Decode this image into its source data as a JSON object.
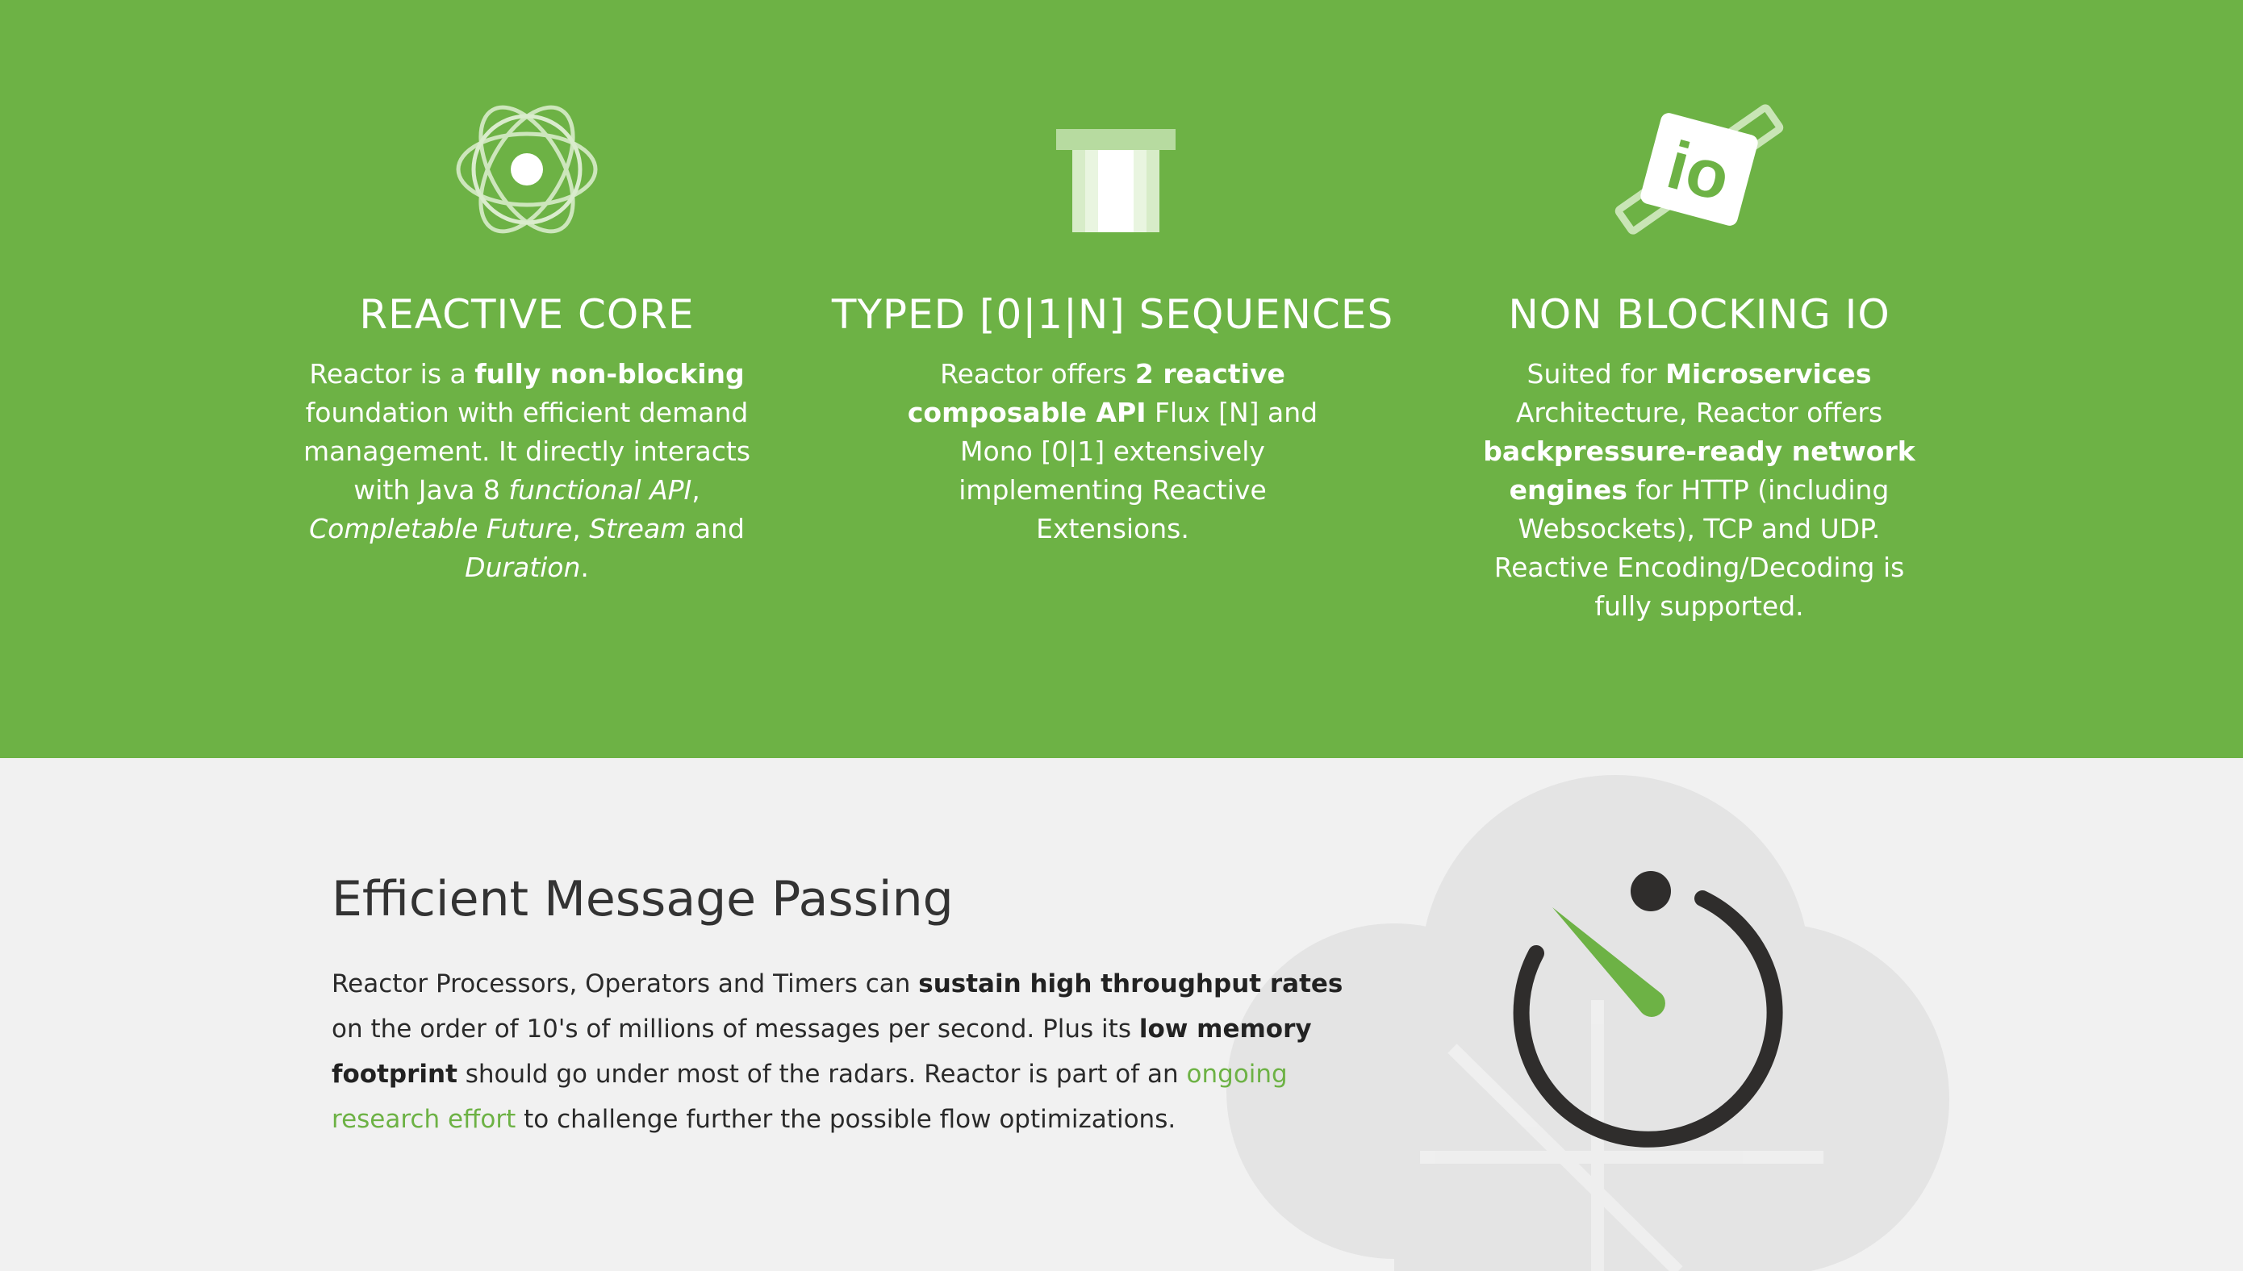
{
  "colors": {
    "brand_green": "#6db245",
    "text_dark": "#333333",
    "background_light": "#f1f1f1"
  },
  "features": [
    {
      "icon": "atom-icon",
      "title": "REACTIVE CORE",
      "body": [
        {
          "t": "Reactor is a "
        },
        {
          "t": "fully non-blocking",
          "b": true
        },
        {
          "t": " foundation with efficient demand management. It directly interacts with Java 8 "
        },
        {
          "t": "functional API",
          "i": true
        },
        {
          "t": ", "
        },
        {
          "t": "Completable Future",
          "i": true
        },
        {
          "t": ", "
        },
        {
          "t": "Stream",
          "i": true
        },
        {
          "t": " and "
        },
        {
          "t": "Duration",
          "i": true
        },
        {
          "t": "."
        }
      ]
    },
    {
      "icon": "sequence-pipe-icon",
      "title": "TYPED [0|1|N] SEQUENCES",
      "body": [
        {
          "t": "Reactor offers "
        },
        {
          "t": "2 reactive composable API",
          "b": true
        },
        {
          "t": " Flux [N] and Mono [0|1] extensively implementing Reactive Extensions."
        }
      ]
    },
    {
      "icon": "io-plug-icon",
      "title": "NON BLOCKING IO",
      "body": [
        {
          "t": "Suited for "
        },
        {
          "t": "Microservices",
          "b": true
        },
        {
          "t": " Architecture, Reactor offers "
        },
        {
          "t": "backpressure-ready network engines",
          "b": true
        },
        {
          "t": " for HTTP (including Websockets), TCP and UDP. Reactive Encoding/Decoding is fully supported."
        }
      ]
    }
  ],
  "message_section": {
    "title": "Efficient Message Passing",
    "icon": "stopwatch-icon",
    "body": [
      {
        "t": "Reactor Processors, Operators and Timers can "
      },
      {
        "t": "sustain high throughput rates",
        "b": true
      },
      {
        "t": " on the order of 10's of millions of messages per second. Plus its "
      },
      {
        "t": "low memory footprint",
        "b": true
      },
      {
        "t": " should go under most of the radars. Reactor is part of an "
      },
      {
        "t": "ongoing research effort",
        "link": true
      },
      {
        "t": " to challenge further the possible flow optimizations."
      }
    ]
  }
}
